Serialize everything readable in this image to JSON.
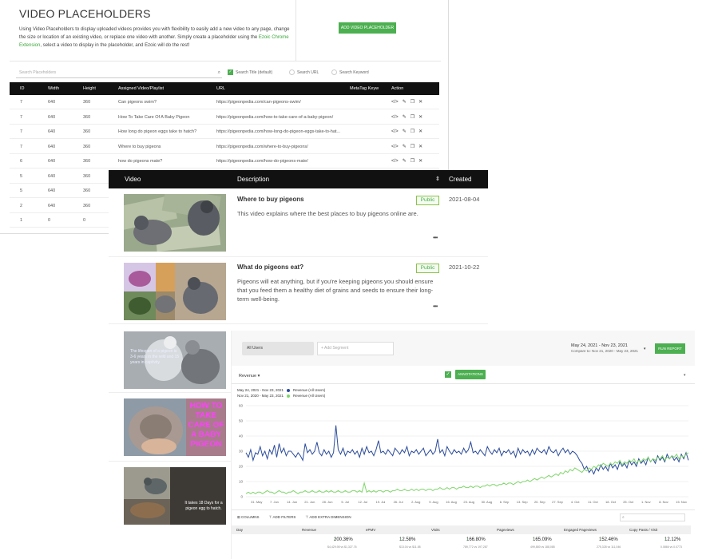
{
  "placeholders": {
    "title": "VIDEO PLACEHOLDERS",
    "description": "Using Video Placeholders to display uploaded videos provides you with flexibility to easily add a new video to any page, change the size or location of an existing video, or replace one video with another. Simply create a placeholder using the",
    "description_link": "Ezoic Chrome Extension",
    "description_end": ", select a video to display in the placeholder, and Ezoic will do the rest!",
    "add_button": "ADD VIDEO PLACEHOLDER",
    "search_placeholder": "Search Placeholders",
    "search_options": [
      "Search Title (default)",
      "Search URL",
      "Search Keyword"
    ],
    "columns": [
      "ID",
      "Width",
      "Height",
      "Assigned Video/Playlist",
      "URL",
      "MetaTag Keyw",
      "Action"
    ],
    "rows": [
      {
        "id": "7",
        "width": "640",
        "height": "360",
        "video": "Can pigeons swim?",
        "url": "https://pigeonpedia.com/can-pigeons-swim/"
      },
      {
        "id": "7",
        "width": "640",
        "height": "360",
        "video": "How To Take Care Of A Baby Pigeon",
        "url": "https://pigeonpedia.com/how-to-take-care-of-a-baby-pigeon/"
      },
      {
        "id": "7",
        "width": "640",
        "height": "360",
        "video": "How long do pigeon eggs take to hatch?",
        "url": "https://pigeonpedia.com/how-long-do-pigeon-eggs-take-to-hat..."
      },
      {
        "id": "7",
        "width": "640",
        "height": "360",
        "video": "Where to buy pigeons",
        "url": "https://pigeonpedia.com/where-to-buy-pigeons/"
      },
      {
        "id": "6",
        "width": "640",
        "height": "360",
        "video": "how do pigeons mate?",
        "url": "https://pigeonpedia.com/how-do-pigeons-mate/"
      },
      {
        "id": "5",
        "width": "640",
        "height": "360",
        "video": "",
        "url": ""
      },
      {
        "id": "5",
        "width": "640",
        "height": "360",
        "video": "",
        "url": ""
      },
      {
        "id": "2",
        "width": "640",
        "height": "360",
        "video": "",
        "url": ""
      },
      {
        "id": "1",
        "width": "0",
        "height": "0",
        "video": "",
        "url": ""
      }
    ]
  },
  "videos": {
    "columns": [
      "Video",
      "Description",
      "Created"
    ],
    "items": [
      {
        "title": "Where to buy pigeons",
        "description": "This video explains where the best places to buy pigeons online are.",
        "status": "Public",
        "created": "2021-08-04",
        "thumb_text": ""
      },
      {
        "title": "What do pigeons eat?",
        "description": "Pigeons will eat anything, but if you're keeping pigeons you should ensure that you feed them a healthy diet of grains and seeds to ensure their long-term well-being.",
        "status": "Public",
        "created": "2021-10-22",
        "thumb_text": ""
      },
      {
        "title": "",
        "description": "",
        "status": "",
        "created": "",
        "thumb_text": "The lifespan of a pigeon is 3-6 years in the wild and 15 years in captivity"
      },
      {
        "title": "",
        "description": "",
        "status": "",
        "created": "",
        "thumb_text": "HOW TO TAKE CARE OF A BABY PIGEON"
      },
      {
        "title": "",
        "description": "",
        "status": "",
        "created": "",
        "thumb_text": "It takes 18 Days for a pigeon egg to hatch."
      }
    ],
    "more": "•••"
  },
  "analytics": {
    "segment": "All Users",
    "add_segment": "+ Add Segment",
    "date_range": "May 24, 2021 - Nov 23, 2021",
    "compare": "Compare to: Nov 21, 2020 - May 23, 2021",
    "run_button": "RUN REPORT",
    "metric": "Revenue",
    "annotations": "ANNOTATIONS",
    "legend": [
      {
        "range": "May 24, 2021 - Nov 23, 2021",
        "label": "Revenue (All Users)",
        "color": "#2b4b9b"
      },
      {
        "range": "Nov 21, 2020 - May 23, 2021",
        "label": "Revenue (All Users)",
        "color": "#7fd66a"
      }
    ],
    "tools": [
      "COLUMNS",
      "ADD FILTERS",
      "ADD EXTRA DIMENSION"
    ],
    "table_columns": [
      "Day",
      "Revenue",
      "ePMV",
      "Visits",
      "Pageviews",
      "Engaged Pageviews",
      "Copy Pasts / Visit"
    ],
    "table_values": [
      "200.36%",
      "12.58%",
      "166.80%",
      "165.09%",
      "152.46%",
      "12.12%"
    ],
    "table_subs": [
      "$4,429.98 vs $1,327.76",
      "$13.04 vs $11.58",
      "789,772 vs 197,287",
      "499,880 vs 188,085",
      "275,328 vs 111,046",
      "0.0866 vs 0.0773"
    ]
  },
  "chart_data": {
    "type": "line",
    "x": [
      "31. May",
      "7. Jun",
      "14. Jun",
      "21. Jun",
      "28. Jun",
      "5. Jul",
      "12. Jul",
      "19. Jul",
      "26. Jul",
      "2. Aug",
      "9. Aug",
      "16. Aug",
      "23. Aug",
      "30. Aug",
      "6. Sep",
      "13. Sep",
      "20. Sep",
      "27. Sep",
      "4. Oct",
      "11. Oct",
      "18. Oct",
      "25. Oct",
      "1. Nov",
      "8. Nov",
      "15. Nov"
    ],
    "ylim": [
      0,
      60
    ],
    "yticks": [
      0,
      10,
      20,
      30,
      40,
      50,
      60
    ],
    "series": [
      {
        "name": "Revenue (All Users)",
        "color": "#2b4b9b",
        "values": [
          29,
          26,
          31,
          24,
          29,
          28,
          33,
          27,
          30,
          25,
          31,
          28,
          34,
          26,
          35,
          29,
          32,
          27,
          30,
          30,
          28,
          26,
          29,
          27,
          24,
          35,
          29,
          31,
          28,
          30,
          36,
          29,
          27,
          31,
          28,
          30,
          26,
          29,
          47,
          31,
          28,
          32,
          27,
          30,
          29,
          31,
          28,
          30,
          26,
          32,
          28,
          33,
          29,
          30,
          27,
          31,
          37,
          29,
          30,
          28,
          31,
          29,
          27,
          32,
          30,
          28,
          31,
          29,
          33,
          27,
          30,
          29,
          31,
          28,
          30,
          32,
          27,
          29,
          31,
          28,
          30,
          38,
          29,
          31,
          27,
          33,
          30,
          28,
          31,
          29,
          30,
          28,
          32,
          29,
          31,
          36,
          29,
          30,
          28,
          31,
          29,
          27,
          33,
          30,
          28,
          31,
          29,
          32,
          27,
          30,
          29,
          31,
          28,
          30,
          26,
          32,
          28,
          31,
          29,
          30,
          27,
          31,
          28,
          32,
          30,
          29,
          31,
          28,
          33,
          30,
          29,
          31,
          27,
          30,
          32,
          29,
          31,
          28,
          30,
          29,
          27,
          24,
          22,
          18,
          20,
          16,
          18,
          15,
          19,
          17,
          21,
          18,
          20,
          17,
          22,
          19,
          21,
          18,
          23,
          20,
          22,
          19,
          24,
          21,
          23,
          20,
          25,
          22,
          24,
          21,
          26,
          23,
          25,
          22,
          27,
          24,
          26,
          23,
          28,
          25,
          27,
          24,
          26,
          23,
          28,
          25,
          29,
          24
        ]
      },
      {
        "name": "Revenue (All Users)",
        "color": "#7fd66a",
        "values": [
          2,
          3,
          2,
          3,
          2,
          3,
          3,
          2,
          3,
          4,
          3,
          3,
          2,
          3,
          4,
          3,
          3,
          2,
          3,
          3,
          4,
          3,
          2,
          3,
          3,
          4,
          3,
          3,
          4,
          3,
          3,
          4,
          3,
          3,
          4,
          3,
          4,
          3,
          3,
          4,
          3,
          3,
          4,
          3,
          3,
          4,
          4,
          3,
          4,
          3,
          9,
          3,
          4,
          3,
          4,
          3,
          4,
          4,
          3,
          4,
          4,
          3,
          4,
          4,
          5,
          4,
          4,
          5,
          4,
          4,
          5,
          4,
          5,
          4,
          5,
          5,
          4,
          5,
          5,
          4,
          5,
          5,
          6,
          5,
          5,
          6,
          5,
          6,
          6,
          5,
          6,
          6,
          7,
          6,
          6,
          7,
          6,
          7,
          7,
          6,
          7,
          7,
          8,
          7,
          8,
          8,
          7,
          8,
          8,
          9,
          8,
          9,
          9,
          8,
          9,
          10,
          9,
          10,
          10,
          11,
          10,
          11,
          12,
          11,
          12,
          13,
          12,
          13,
          14,
          13,
          14,
          15,
          14,
          16,
          15,
          17,
          16,
          18,
          17,
          19,
          18,
          17,
          16,
          18,
          17,
          19,
          18,
          20,
          19,
          21,
          20,
          22,
          21,
          20,
          22,
          21,
          23,
          22,
          24,
          21,
          23,
          22,
          24,
          23,
          25,
          22,
          24,
          23,
          25,
          24,
          26,
          23,
          25,
          24,
          26,
          25,
          27,
          24,
          26,
          25,
          27,
          26,
          28,
          25,
          27,
          26,
          28,
          29
        ]
      }
    ]
  }
}
